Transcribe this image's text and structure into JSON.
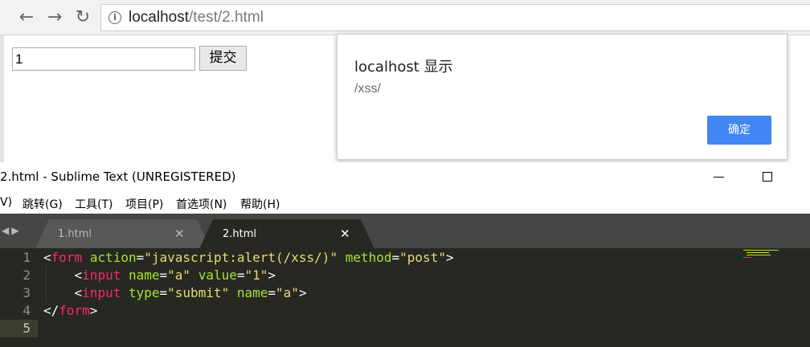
{
  "browser": {
    "nav": {
      "back_icon": "arrow-left-icon",
      "forward_icon": "arrow-right-icon",
      "reload_icon": "reload-icon"
    },
    "omnibox": {
      "host": "localhost",
      "path": "/test/2.html"
    },
    "page": {
      "input_value": "1",
      "submit_label": "提交"
    },
    "alert": {
      "title": "localhost 显示",
      "message": "/xss/",
      "ok_label": "确定",
      "ok_color": "#4285f4"
    }
  },
  "sublime": {
    "window_title": "2.html - Sublime Text (UNREGISTERED)",
    "menu": [
      "V)",
      "跳转(G)",
      "工具(T)",
      "项目(P)",
      "首选项(N)",
      "帮助(H)"
    ],
    "tabs": [
      {
        "label": "1.html",
        "active": false
      },
      {
        "label": "2.html",
        "active": true
      }
    ],
    "line_numbers": [
      "1",
      "2",
      "3",
      "4",
      "5"
    ],
    "code": [
      [
        {
          "t": "punct",
          "v": "<"
        },
        {
          "t": "tag",
          "v": "form"
        },
        {
          "t": "punct",
          "v": " "
        },
        {
          "t": "attr",
          "v": "action"
        },
        {
          "t": "punct",
          "v": "="
        },
        {
          "t": "str",
          "v": "\"javascript:alert(/xss/)\""
        },
        {
          "t": "punct",
          "v": " "
        },
        {
          "t": "attr",
          "v": "method"
        },
        {
          "t": "punct",
          "v": "="
        },
        {
          "t": "str",
          "v": "\"post\""
        },
        {
          "t": "punct",
          "v": ">"
        }
      ],
      [
        {
          "t": "punct",
          "v": "    <"
        },
        {
          "t": "tag",
          "v": "input"
        },
        {
          "t": "punct",
          "v": " "
        },
        {
          "t": "attr",
          "v": "name"
        },
        {
          "t": "punct",
          "v": "="
        },
        {
          "t": "str",
          "v": "\"a\""
        },
        {
          "t": "punct",
          "v": " "
        },
        {
          "t": "attr",
          "v": "value"
        },
        {
          "t": "punct",
          "v": "="
        },
        {
          "t": "str",
          "v": "\"1\""
        },
        {
          "t": "punct",
          "v": ">"
        }
      ],
      [
        {
          "t": "punct",
          "v": "    <"
        },
        {
          "t": "tag",
          "v": "input"
        },
        {
          "t": "punct",
          "v": " "
        },
        {
          "t": "attr",
          "v": "type"
        },
        {
          "t": "punct",
          "v": "="
        },
        {
          "t": "str",
          "v": "\"submit\""
        },
        {
          "t": "punct",
          "v": " "
        },
        {
          "t": "attr",
          "v": "name"
        },
        {
          "t": "punct",
          "v": "="
        },
        {
          "t": "str",
          "v": "\"a\""
        },
        {
          "t": "punct",
          "v": ">"
        }
      ],
      [
        {
          "t": "punct",
          "v": "</"
        },
        {
          "t": "tag",
          "v": "form"
        },
        {
          "t": "punct",
          "v": ">"
        }
      ],
      []
    ],
    "colors": {
      "editor_bg": "#272822",
      "tag": "#f92672",
      "attr": "#a6e22e",
      "string": "#e6db74",
      "text": "#f8f8f2",
      "tab_bar": "#464646"
    }
  }
}
